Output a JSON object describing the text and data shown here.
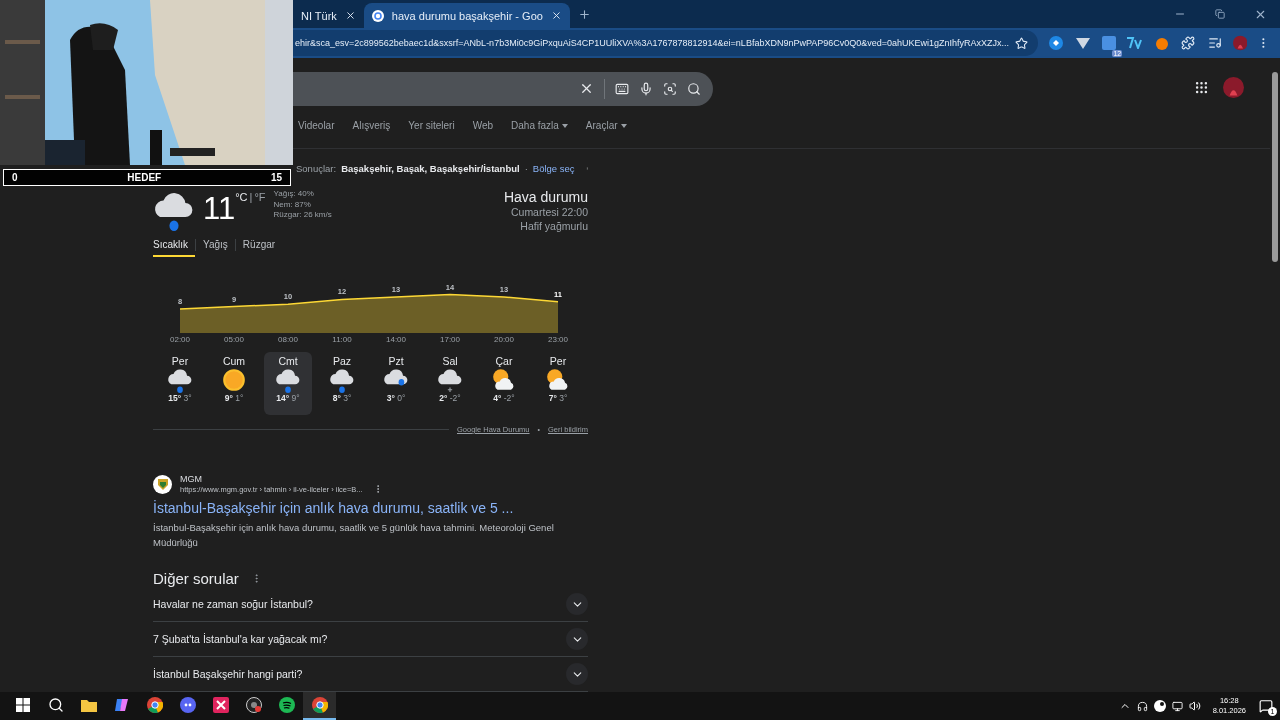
{
  "browser": {
    "tabs": [
      {
        "title": "NI Türk",
        "selected": false
      },
      {
        "title": "hava durumu başakşehir - Goo",
        "selected": true
      }
    ],
    "url": "ehir&sca_esv=2c899562bebaec1d&sxsrf=ANbL-n7b3Mi0c9GiPxquAiS4CP1UUliXVA%3A1767878812914&ei=nLBfabXDN9nPwPAP96Cv0Q0&ved=0ahUKEwi1gZnIhfyRAxXZJx...",
    "extension_badge": "12"
  },
  "stream_overlay": {
    "goal_start": "0",
    "goal_label": "HEDEF",
    "goal_end": "15"
  },
  "search_nav": [
    {
      "label": "Videolar",
      "dropdown": false
    },
    {
      "label": "Alışveriş",
      "dropdown": false
    },
    {
      "label": "Yer siteleri",
      "dropdown": false
    },
    {
      "label": "Web",
      "dropdown": false
    },
    {
      "label": "Daha fazla",
      "dropdown": true
    },
    {
      "label": "Araçlar",
      "dropdown": true
    }
  ],
  "location": {
    "prefix": "Sonuçlar:",
    "place": "Başakşehir, Başak, Başakşehir/İstanbul",
    "separator": "·",
    "link": "Bölge seç"
  },
  "weather": {
    "temp": "11",
    "unit_c": "°C",
    "unit_f": "°F",
    "unit_separator": "|",
    "details": [
      "Yağış: 40%",
      "Nem: 87%",
      "Rüzgar: 26 km/s"
    ],
    "title": "Hava durumu",
    "time": "Cumartesi 22:00",
    "condition": "Hafif yağmurlu",
    "tabs": [
      {
        "label": "Sıcaklık",
        "selected": true
      },
      {
        "label": "Yağış",
        "selected": false
      },
      {
        "label": "Rüzgar",
        "selected": false
      }
    ],
    "chart_data": {
      "type": "area",
      "categories": [
        "02:00",
        "05:00",
        "08:00",
        "11:00",
        "14:00",
        "17:00",
        "20:00",
        "23:00"
      ],
      "series": [
        {
          "color": "#fdd835",
          "values": [
            8,
            9,
            10,
            12,
            13,
            14,
            13,
            11
          ]
        }
      ],
      "data_labels": true
    },
    "days": [
      {
        "name": "Per",
        "kind": "rain",
        "high": "15°",
        "low": "3°",
        "selected": false
      },
      {
        "name": "Cum",
        "kind": "sun",
        "high": "9°",
        "low": "1°",
        "selected": false
      },
      {
        "name": "Cmt",
        "kind": "rain",
        "high": "14°",
        "low": "9°",
        "selected": true
      },
      {
        "name": "Paz",
        "kind": "rain",
        "high": "8°",
        "low": "3°",
        "selected": false
      },
      {
        "name": "Pzt",
        "kind": "sleet",
        "high": "3°",
        "low": "0°",
        "selected": false
      },
      {
        "name": "Sal",
        "kind": "snow",
        "high": "2°",
        "low": "-2°",
        "selected": false
      },
      {
        "name": "Çar",
        "kind": "partly",
        "high": "4°",
        "low": "-2°",
        "selected": false
      },
      {
        "name": "Per",
        "kind": "partly",
        "high": "7°",
        "low": "3°",
        "selected": false
      }
    ],
    "footer_links": [
      "Google Hava Durumu",
      "Geri bildirim"
    ],
    "footer_separator": "•"
  },
  "result": {
    "site": "MGM",
    "url": "https://www.mgm.gov.tr › tahmin › il-ve-ilceler › ilce=B...",
    "title": "İstanbul-Başakşehir için anlık hava durumu, saatlik ve 5 ...",
    "snippet": "İstanbul-Başakşehir için anlık hava durumu, saatlik ve 5 günlük hava tahmini. Meteoroloji Genel Müdürlüğü"
  },
  "other_questions": {
    "title": "Diğer sorular",
    "items": [
      "Havalar ne zaman soğur İstanbul?",
      "7 Şubat'ta İstanbul'a kar yağacak mı?",
      "İstanbul Başakşehir hangi parti?"
    ]
  },
  "taskbar": {
    "apps": [
      {
        "kind": "folder",
        "active": false
      },
      {
        "kind": "copilot",
        "active": false
      },
      {
        "kind": "browser",
        "active": false
      },
      {
        "kind": "chat",
        "active": false
      },
      {
        "kind": "xapp",
        "active": false
      },
      {
        "kind": "recorder",
        "active": false
      },
      {
        "kind": "music",
        "active": false
      },
      {
        "kind": "browser",
        "active": true
      }
    ],
    "time": "16:28",
    "date": "8.01.2026",
    "notifications": "1"
  }
}
